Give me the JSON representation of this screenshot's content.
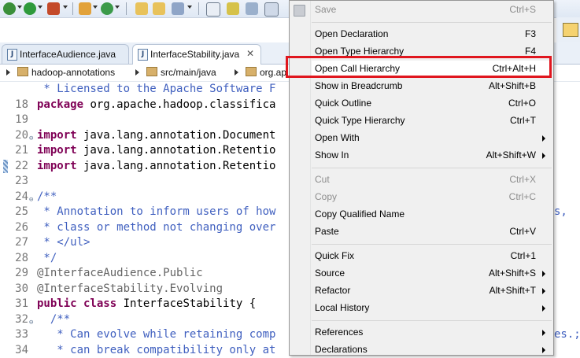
{
  "colors": {
    "highlight_border": "#e0161e",
    "keyword": "#7f0055",
    "comment": "#3f5fbf",
    "annotation": "#646464",
    "line_number": "#787878",
    "menu_bg": "#f0f0f0",
    "disabled_text": "#8d8d8d"
  },
  "tabs": [
    {
      "label": "InterfaceAudience.java",
      "icon": "java-file-icon"
    },
    {
      "label": "InterfaceStability.java",
      "icon": "java-file-icon",
      "close": "✕"
    }
  ],
  "breadcrumb": {
    "items": [
      "hadoop-annotations",
      "src/main/java",
      "org.ap"
    ]
  },
  "editor": {
    "lines": [
      {
        "num": "",
        "html": "<span class='cm'> * Licensed to the Apache Software F</span>"
      },
      {
        "num": "18",
        "html": "<span class='kw'>package</span> org.apache.hadoop.classifica"
      },
      {
        "num": "19",
        "html": ""
      },
      {
        "num": "20",
        "fold": true,
        "html": "<span class='kw'>import</span> java.lang.annotation.Document"
      },
      {
        "num": "21",
        "html": "<span class='kw'>import</span> java.lang.annotation.Retentio"
      },
      {
        "num": "22",
        "marker": true,
        "html": "<span class='kw'>import</span> java.lang.annotation.Retentio"
      },
      {
        "num": "23",
        "html": ""
      },
      {
        "num": "24",
        "fold": true,
        "html": "<span class='cm'>/**</span>"
      },
      {
        "num": "25",
        "html": "<span class='cm'> * Annotation to inform users of how</span>"
      },
      {
        "num": "26",
        "html": "<span class='cm'> * class or method not changing over</span>"
      },
      {
        "num": "27",
        "html": "<span class='cm'> * &lt;/ul&gt;</span>"
      },
      {
        "num": "28",
        "html": "<span class='cm'> */</span>"
      },
      {
        "num": "29",
        "html": "<span class='ann'>@InterfaceAudience.Public</span>"
      },
      {
        "num": "30",
        "html": "<span class='ann'>@InterfaceStability.Evolving</span>"
      },
      {
        "num": "31",
        "html": "<span class='kw'>public class</span> InterfaceStability {"
      },
      {
        "num": "32",
        "fold": true,
        "html": "<span class='cm'>  /**</span>"
      },
      {
        "num": "33",
        "html": "<span class='cm'>   * Can evolve while retaining comp</span>"
      },
      {
        "num": "34",
        "html": "<span class='cm'>   * can break compatibility only at</span>"
      }
    ],
    "overflow_right": [
      {
        "line": 25,
        "text": "s,"
      },
      {
        "line": 33,
        "text": "es.;"
      }
    ]
  },
  "context_menu": {
    "items": [
      {
        "type": "item",
        "label": "Save",
        "accel": "Ctrl+S",
        "disabled": true,
        "icon": "save-icon"
      },
      {
        "type": "sep"
      },
      {
        "type": "item",
        "label": "Open Declaration",
        "accel": "F3"
      },
      {
        "type": "item",
        "label": "Open Type Hierarchy",
        "accel": "F4"
      },
      {
        "type": "item",
        "label": "Open Call Hierarchy",
        "accel": "Ctrl+Alt+H",
        "highlight": true
      },
      {
        "type": "item",
        "label": "Show in Breadcrumb",
        "accel": "Alt+Shift+B"
      },
      {
        "type": "item",
        "label": "Quick Outline",
        "accel": "Ctrl+O"
      },
      {
        "type": "item",
        "label": "Quick Type Hierarchy",
        "accel": "Ctrl+T"
      },
      {
        "type": "item",
        "label": "Open With",
        "accel": "",
        "submenu": true
      },
      {
        "type": "item",
        "label": "Show In",
        "accel": "Alt+Shift+W",
        "submenu": true
      },
      {
        "type": "sep"
      },
      {
        "type": "item",
        "label": "Cut",
        "accel": "Ctrl+X",
        "disabled": true
      },
      {
        "type": "item",
        "label": "Copy",
        "accel": "Ctrl+C",
        "disabled": true
      },
      {
        "type": "item",
        "label": "Copy Qualified Name",
        "accel": ""
      },
      {
        "type": "item",
        "label": "Paste",
        "accel": "Ctrl+V"
      },
      {
        "type": "sep"
      },
      {
        "type": "item",
        "label": "Quick Fix",
        "accel": "Ctrl+1"
      },
      {
        "type": "item",
        "label": "Source",
        "accel": "Alt+Shift+S",
        "submenu": true
      },
      {
        "type": "item",
        "label": "Refactor",
        "accel": "Alt+Shift+T",
        "submenu": true
      },
      {
        "type": "item",
        "label": "Local History",
        "accel": "",
        "submenu": true
      },
      {
        "type": "sep"
      },
      {
        "type": "item",
        "label": "References",
        "accel": "",
        "submenu": true
      },
      {
        "type": "item",
        "label": "Declarations",
        "accel": "",
        "submenu": true
      }
    ]
  }
}
